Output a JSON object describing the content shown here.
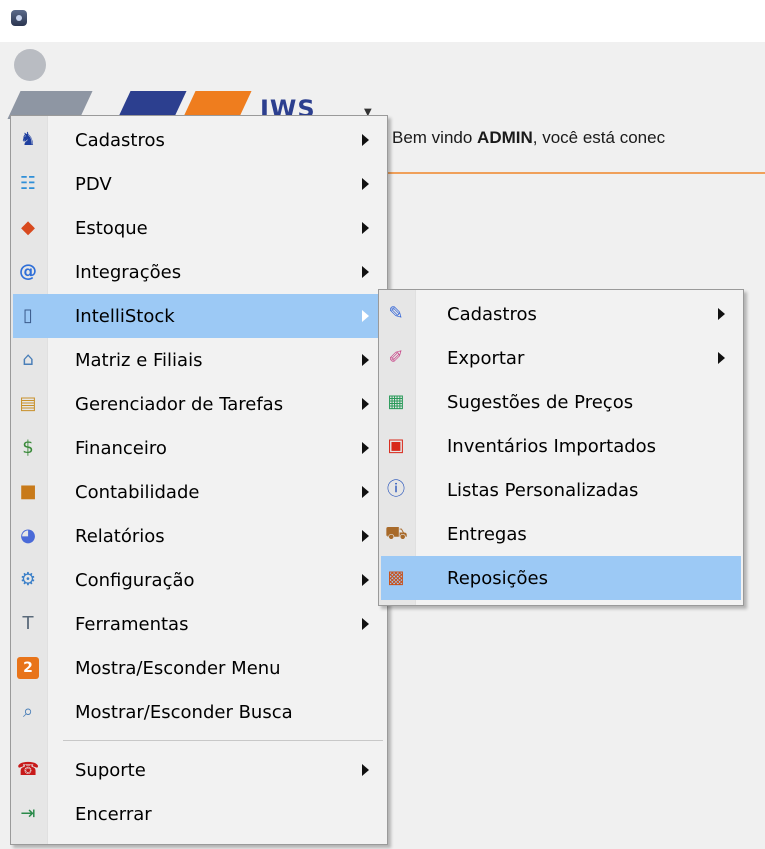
{
  "header": {
    "logo_text": "IWS",
    "welcome_prefix": "Bem vindo ",
    "user": "ADMIN",
    "welcome_suffix": ", você está conec"
  },
  "main_menu": {
    "items": [
      {
        "label": "Cadastros",
        "icon": "cadastros-icon",
        "submenu": true
      },
      {
        "label": "PDV",
        "icon": "cart-icon",
        "submenu": true
      },
      {
        "label": "Estoque",
        "icon": "boxes-icon",
        "submenu": true
      },
      {
        "label": "Integrações",
        "icon": "at-icon",
        "submenu": true
      },
      {
        "label": "IntelliStock",
        "icon": "device-icon",
        "submenu": true,
        "highlighted": true
      },
      {
        "label": "Matriz e Filiais",
        "icon": "house-icon",
        "submenu": true
      },
      {
        "label": "Gerenciador de Tarefas",
        "icon": "clipboard-icon",
        "submenu": true
      },
      {
        "label": "Financeiro",
        "icon": "money-bag-icon",
        "submenu": true
      },
      {
        "label": "Contabilidade",
        "icon": "briefcase-icon",
        "submenu": true
      },
      {
        "label": "Relatórios",
        "icon": "reports-icon",
        "submenu": true
      },
      {
        "label": "Configuração",
        "icon": "config-icon",
        "submenu": true
      },
      {
        "label": "Ferramentas",
        "icon": "hammer-icon",
        "submenu": true
      },
      {
        "label": "Mostra/Esconder Menu",
        "icon": "toggle-menu-icon",
        "submenu": false
      },
      {
        "label": "Mostrar/Esconder Busca",
        "icon": "magnifier-icon",
        "submenu": false
      },
      {
        "label": "Suporte",
        "icon": "phone-icon",
        "submenu": true
      },
      {
        "label": "Encerrar",
        "icon": "exit-icon",
        "submenu": false
      }
    ]
  },
  "sub_menu": {
    "items": [
      {
        "label": "Cadastros",
        "icon": "pencil-icon",
        "submenu": true
      },
      {
        "label": "Exportar",
        "icon": "export-icon",
        "submenu": true
      },
      {
        "label": "Sugestões de Preços",
        "icon": "calculator-icon",
        "submenu": false
      },
      {
        "label": "Inventários Importados",
        "icon": "inventory-icon",
        "submenu": false
      },
      {
        "label": "Listas Personalizadas",
        "icon": "info-icon",
        "submenu": false
      },
      {
        "label": "Entregas",
        "icon": "truck-icon",
        "submenu": false
      },
      {
        "label": "Reposições",
        "icon": "package-icon",
        "submenu": false,
        "highlighted": true
      }
    ]
  },
  "colors": {
    "highlight": "#9cc9f5",
    "accent_line": "#f0a05a",
    "logo_blue": "#2c3f8f",
    "logo_orange": "#ef7d1e"
  }
}
